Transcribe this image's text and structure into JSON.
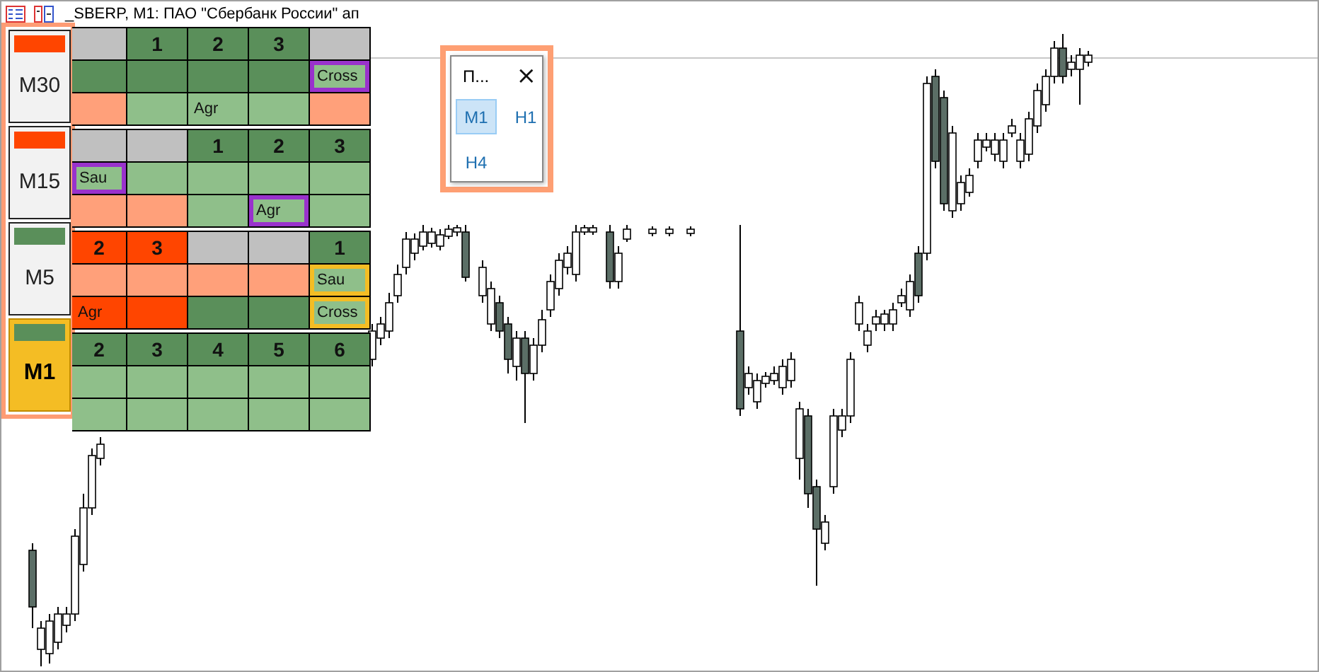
{
  "window": {
    "title": "_SBERP, M1:  ПАО \"Сбербанк России\" ап"
  },
  "timeframes": [
    {
      "label": "M30",
      "selected": false,
      "color": "#ff4500"
    },
    {
      "label": "M15",
      "selected": false,
      "color": "#ff4500"
    },
    {
      "label": "M5",
      "selected": false,
      "color": "#5a8f5a"
    },
    {
      "label": "M1",
      "selected": true,
      "color": "#5a8f5a"
    }
  ],
  "blocks": [
    {
      "rows": [
        [
          {
            "color": "#c0c0c0"
          },
          {
            "kind": "number",
            "text": "1",
            "color": "#5a8f5a"
          },
          {
            "kind": "number",
            "text": "2",
            "color": "#5a8f5a"
          },
          {
            "kind": "number",
            "text": "3",
            "color": "#5a8f5a"
          },
          {
            "color": "#c0c0c0"
          }
        ],
        [
          {
            "color": "#5a8f5a"
          },
          {
            "color": "#5a8f5a"
          },
          {
            "color": "#5a8f5a"
          },
          {
            "color": "#5a8f5a"
          },
          {
            "kind": "tag",
            "text": "Cross",
            "color": "#8fbf8a",
            "highlight": {
              "color": "#9932cc"
            }
          }
        ],
        [
          {
            "color": "#ffa07a"
          },
          {
            "color": "#8fbf8a"
          },
          {
            "kind": "tag",
            "text": "Agr",
            "color": "#8fbf8a"
          },
          {
            "color": "#8fbf8a"
          },
          {
            "color": "#ffa07a"
          }
        ]
      ]
    },
    {
      "rows": [
        [
          {
            "color": "#c0c0c0"
          },
          {
            "color": "#c0c0c0"
          },
          {
            "kind": "number",
            "text": "1",
            "color": "#5a8f5a"
          },
          {
            "kind": "number",
            "text": "2",
            "color": "#5a8f5a"
          },
          {
            "kind": "number",
            "text": "3",
            "color": "#5a8f5a"
          }
        ],
        [
          {
            "kind": "tag",
            "text": "Sau",
            "color": "#8fbf8a",
            "highlight": {
              "color": "#9932cc"
            }
          },
          {
            "color": "#8fbf8a"
          },
          {
            "color": "#8fbf8a"
          },
          {
            "color": "#8fbf8a"
          },
          {
            "color": "#8fbf8a"
          }
        ],
        [
          {
            "color": "#ffa07a"
          },
          {
            "color": "#ffa07a"
          },
          {
            "color": "#8fbf8a"
          },
          {
            "kind": "tag",
            "text": "Agr",
            "color": "#8fbf8a",
            "highlight": {
              "color": "#9932cc"
            }
          },
          {
            "color": "#8fbf8a"
          }
        ]
      ]
    },
    {
      "rows": [
        [
          {
            "kind": "number",
            "text": "2",
            "color": "#ff4500"
          },
          {
            "kind": "number",
            "text": "3",
            "color": "#ff4500"
          },
          {
            "color": "#c0c0c0"
          },
          {
            "color": "#c0c0c0"
          },
          {
            "kind": "number",
            "text": "1",
            "color": "#5a8f5a"
          }
        ],
        [
          {
            "color": "#ffa07a"
          },
          {
            "color": "#ffa07a"
          },
          {
            "color": "#ffa07a"
          },
          {
            "color": "#ffa07a"
          },
          {
            "kind": "tag",
            "text": "Sau",
            "color": "#8fbf8a",
            "highlight": {
              "color": "#f4bd24"
            }
          }
        ],
        [
          {
            "kind": "tag",
            "text": "Agr",
            "color": "#ff4500"
          },
          {
            "color": "#ff4500"
          },
          {
            "color": "#5a8f5a"
          },
          {
            "color": "#5a8f5a"
          },
          {
            "kind": "tag",
            "text": "Cross",
            "color": "#8fbf8a",
            "highlight": {
              "color": "#f4bd24"
            }
          }
        ]
      ]
    },
    {
      "rows": [
        [
          {
            "kind": "number",
            "text": "2",
            "color": "#5a8f5a"
          },
          {
            "kind": "number",
            "text": "3",
            "color": "#5a8f5a"
          },
          {
            "kind": "number",
            "text": "4",
            "color": "#5a8f5a"
          },
          {
            "kind": "number",
            "text": "5",
            "color": "#5a8f5a"
          },
          {
            "kind": "number",
            "text": "6",
            "color": "#5a8f5a"
          }
        ],
        [
          {
            "color": "#8fbf8a"
          },
          {
            "color": "#8fbf8a"
          },
          {
            "color": "#8fbf8a"
          },
          {
            "color": "#8fbf8a"
          },
          {
            "color": "#8fbf8a"
          }
        ],
        [
          {
            "color": "#8fbf8a"
          },
          {
            "color": "#8fbf8a"
          },
          {
            "color": "#8fbf8a"
          },
          {
            "color": "#8fbf8a"
          },
          {
            "color": "#8fbf8a"
          }
        ]
      ]
    }
  ],
  "popup": {
    "title": "П...",
    "close": "×",
    "buttons": [
      {
        "label": "M1",
        "selected": true
      },
      {
        "label": "H1",
        "selected": false
      },
      {
        "label": "H4",
        "selected": false
      }
    ]
  }
}
